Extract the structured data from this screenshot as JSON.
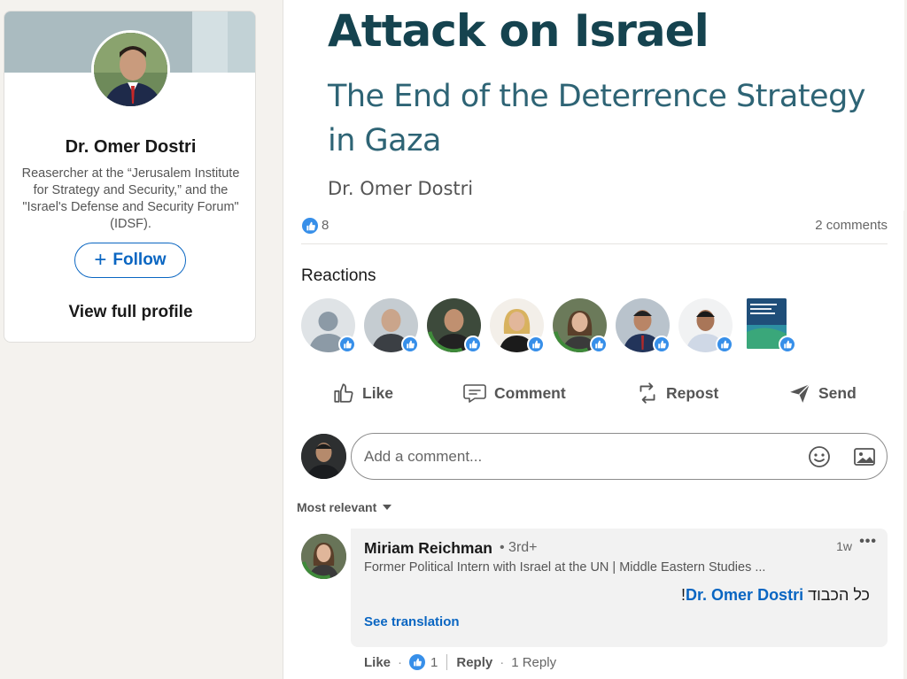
{
  "profile": {
    "name": "Dr. Omer Dostri",
    "headline": "Reasercher at the “Jerusalem Institute for Strategy and Security,” and the \"Israel's Defense and Security Forum\" (IDSF).",
    "follow_label": "Follow",
    "view_profile_label": "View full profile"
  },
  "document": {
    "title": "Attack on Israel",
    "subtitle": "The End of the Deterrence Strategy in Gaza",
    "author": "Dr. Omer Dostri"
  },
  "social": {
    "like_count": "8",
    "comments_count": "2 comments"
  },
  "reactions": {
    "title": "Reactions",
    "reactors": [
      {
        "kind": "placeholder-avatar",
        "bg": "#dfe3e6"
      },
      {
        "kind": "photo",
        "bg": "#7d8a93"
      },
      {
        "kind": "photo-opentowork",
        "bg": "#3d4a3b"
      },
      {
        "kind": "photo",
        "bg": "#c9a874"
      },
      {
        "kind": "photo-opentowork",
        "bg": "#6b7a5a"
      },
      {
        "kind": "photo",
        "bg": "#9aa7b3"
      },
      {
        "kind": "photo",
        "bg": "#c4c8cb"
      },
      {
        "kind": "book-cover",
        "bg": "#1f4e79"
      }
    ]
  },
  "actions": {
    "like": "Like",
    "comment": "Comment",
    "repost": "Repost",
    "send": "Send"
  },
  "comment_box": {
    "placeholder": "Add a comment..."
  },
  "sort": {
    "label": "Most relevant"
  },
  "comments": [
    {
      "author": "Miriam Reichman",
      "degree": "• 3rd+",
      "headline": "Former Political Intern with Israel at the UN | Middle Eastern Studies ...",
      "time": "1w",
      "text_hebrew": "כל הכבוד",
      "mention": "Dr. Omer Dostri",
      "text_suffix": "!",
      "see_translation": "See translation",
      "like_label": "Like",
      "like_count": "1",
      "reply_label": "Reply",
      "replies_label": "1 Reply"
    }
  ],
  "colors": {
    "accent": "#0a66c2",
    "like_blue": "#378fe9",
    "doc_title": "#15434f",
    "doc_subtitle": "#2e6475"
  }
}
